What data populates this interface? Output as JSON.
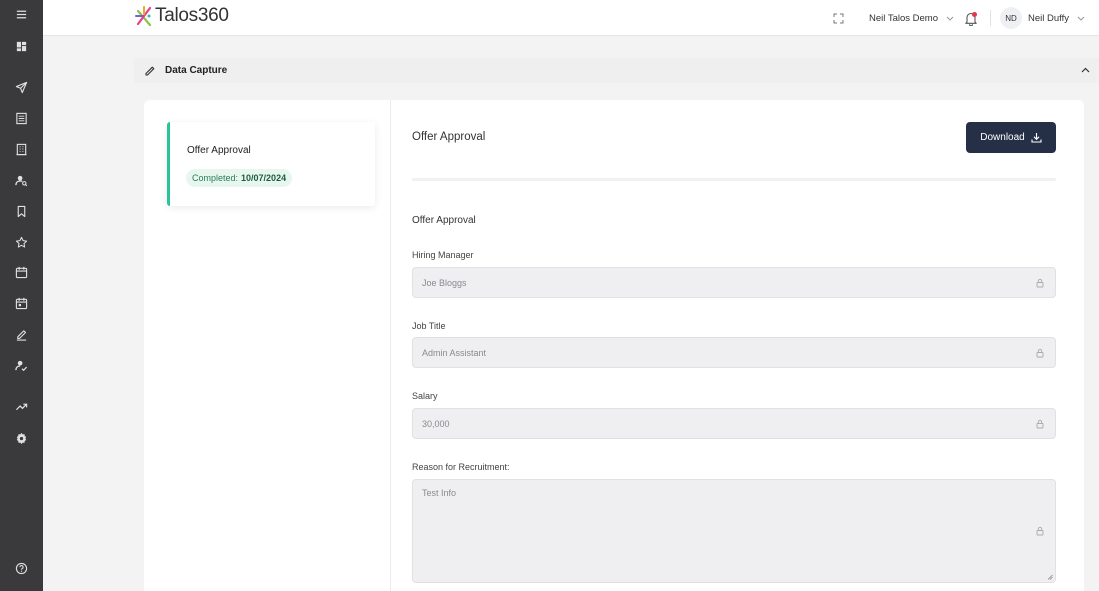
{
  "app": {
    "logo_text": "Talos360"
  },
  "topbar": {
    "org_name": "Neil Talos Demo",
    "user_initials": "ND",
    "user_name": "Neil Duffy"
  },
  "sidebar": {
    "icons": [
      "menu-icon",
      "dashboard-icon",
      "send-icon",
      "list-icon",
      "building-icon",
      "user-search-icon",
      "bookmark-icon",
      "star-icon",
      "calendar-icon",
      "calendar-check-icon",
      "edit-icon",
      "user-check-icon",
      "trend-icon",
      "settings-icon",
      "help-icon"
    ]
  },
  "section": {
    "title": "Data Capture"
  },
  "offer_tile": {
    "title": "Offer Approval",
    "status_label": "Completed:",
    "status_date": "10/07/2024"
  },
  "form": {
    "heading": "Offer Approval",
    "download_label": "Download",
    "subheading": "Offer Approval",
    "fields": [
      {
        "label": "Hiring Manager",
        "value": "Joe Bloggs"
      },
      {
        "label": "Job Title",
        "value": "Admin Assistant"
      },
      {
        "label": "Salary",
        "value": "30,000"
      },
      {
        "label": "Reason for Recruitment:",
        "value": "Test Info"
      }
    ]
  },
  "colors": {
    "sidebar": "#3a3a3c",
    "accent_green": "#2bc49a",
    "download_button": "#253047"
  }
}
